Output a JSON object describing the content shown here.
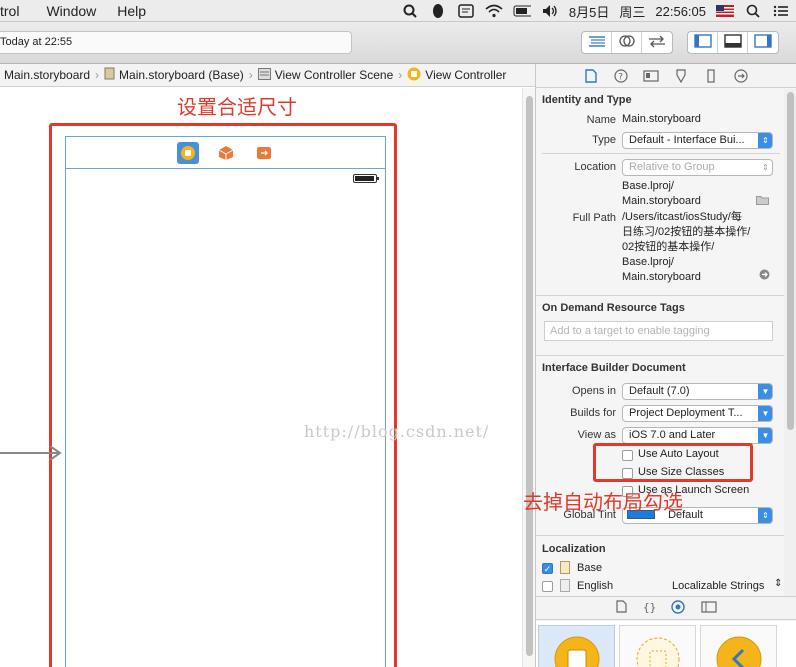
{
  "menubar": {
    "items": [
      "trol",
      "Window",
      "Help"
    ],
    "date": "8月5日",
    "weekday": "周三",
    "time": "22:56:05"
  },
  "toolbar": {
    "activity": "Today at 22:55"
  },
  "jumpbar": {
    "items": [
      "Main.storyboard",
      "Main.storyboard (Base)",
      "View Controller Scene",
      "View Controller"
    ]
  },
  "canvas": {
    "annotation_top": "设置合适尺寸",
    "annotation_right": "去掉自动布局勾选",
    "watermark": "http://blog.csdn.net/"
  },
  "inspector": {
    "identity": {
      "header": "Identity and Type",
      "name_label": "Name",
      "name_value": "Main.storyboard",
      "type_label": "Type",
      "type_value": "Default - Interface Bui...",
      "location_label": "Location",
      "location_value": "Relative to Group",
      "location_path_1": "Base.lproj/",
      "location_path_2": "Main.storyboard",
      "fullpath_label": "Full Path",
      "fullpath_lines": [
        "/Users/itcast/iosStudy/每",
        "日练习/02按钮的基本操作/",
        "02按钮的基本操作/",
        "Base.lproj/",
        "Main.storyboard"
      ]
    },
    "on_demand": {
      "header": "On Demand Resource Tags",
      "placeholder": "Add to a target to enable tagging"
    },
    "ib_document": {
      "header": "Interface Builder Document",
      "opens_in_label": "Opens in",
      "opens_in_value": "Default (7.0)",
      "builds_for_label": "Builds for",
      "builds_for_value": "Project Deployment T...",
      "view_as_label": "View as",
      "view_as_value": "iOS 7.0 and Later",
      "auto_layout": "Use Auto Layout",
      "size_classes": "Use Size Classes",
      "launch_screen": "Use as Launch Screen",
      "global_tint_label": "Global Tint",
      "global_tint_value": "Default",
      "tint_color": "#1a7be0"
    },
    "localization": {
      "header": "Localization",
      "base": "Base",
      "english": "English",
      "english_value": "Localizable Strings"
    }
  },
  "colors": {
    "annotation": "#e3392c",
    "accent": "#3b8ee6",
    "frame": "#6aa5d6"
  }
}
